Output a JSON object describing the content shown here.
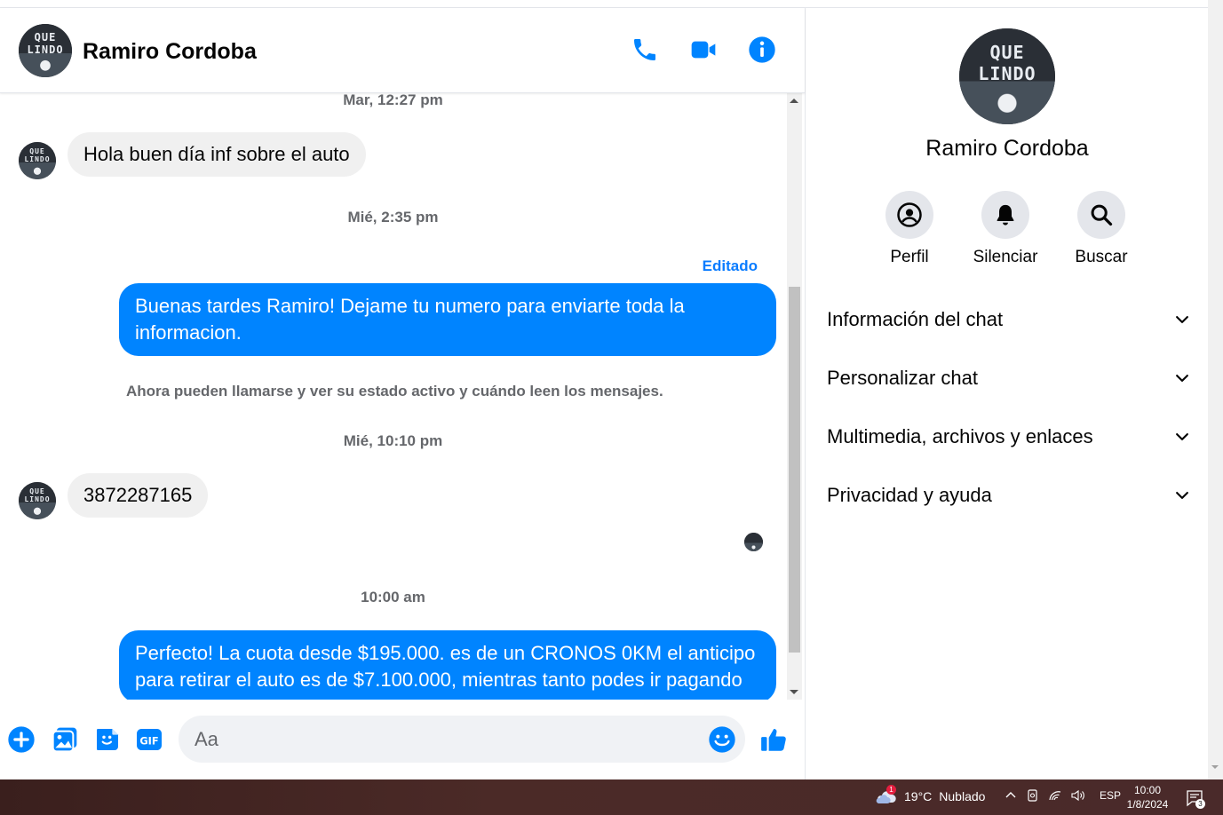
{
  "contact": {
    "name": "Ramiro Cordoba",
    "avatar_text": "QUE LINDO"
  },
  "header": {
    "icons": [
      "phone-icon",
      "video-icon",
      "info-icon"
    ]
  },
  "messages": {
    "ts1": "Mar, 12:27 pm",
    "msg1": "Hola buen día inf sobre el auto",
    "ts2": "Mié, 2:35 pm",
    "edited": "Editado",
    "msg2": "Buenas tardes Ramiro! Dejame tu numero para enviarte toda la informacion.",
    "system": "Ahora pueden llamarse y ver su estado activo y cuándo leen los mensajes.",
    "ts3": "Mié, 10:10 pm",
    "msg3": "3872287165",
    "ts4": "10:00 am",
    "msg4": "Perfecto! La cuota desde $195.000. es de un CRONOS 0KM el anticipo para retirar el auto es de $7.100.000, mientras tanto podes ir pagando"
  },
  "composer": {
    "placeholder": "Aa"
  },
  "side": {
    "actions": [
      {
        "label": "Perfil"
      },
      {
        "label": "Silenciar"
      },
      {
        "label": "Buscar"
      }
    ],
    "sections": [
      {
        "label": "Información del chat"
      },
      {
        "label": "Personalizar chat"
      },
      {
        "label": "Multimedia, archivos y enlaces"
      },
      {
        "label": "Privacidad y ayuda"
      }
    ]
  },
  "taskbar": {
    "weather_badge": "1",
    "temperature": "19°C",
    "condition": "Nublado",
    "language": "ESP",
    "time": "10:00",
    "date": "1/8/2024",
    "notification_count": "3"
  },
  "colors": {
    "accent": "#0084ff",
    "bubble_in": "#f0f0f0",
    "taskbar": "#3a1f1d"
  }
}
